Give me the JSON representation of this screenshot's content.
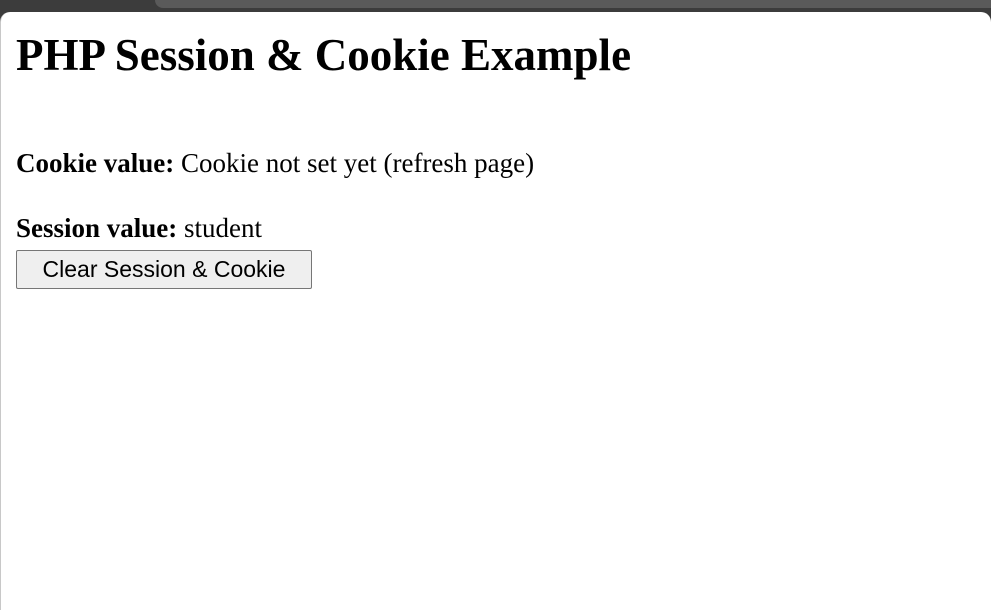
{
  "page": {
    "heading": "PHP Session & Cookie Example",
    "cookie": {
      "label": "Cookie value:",
      "value": "Cookie not set yet (refresh page)"
    },
    "session": {
      "label": "Session value:",
      "value": "student"
    },
    "clear_button_label": "Clear Session & Cookie"
  },
  "colors": {
    "browser_frame": "#3c3c3c",
    "page_background": "#ffffff",
    "button_background": "#efefef",
    "button_border": "#767676"
  }
}
